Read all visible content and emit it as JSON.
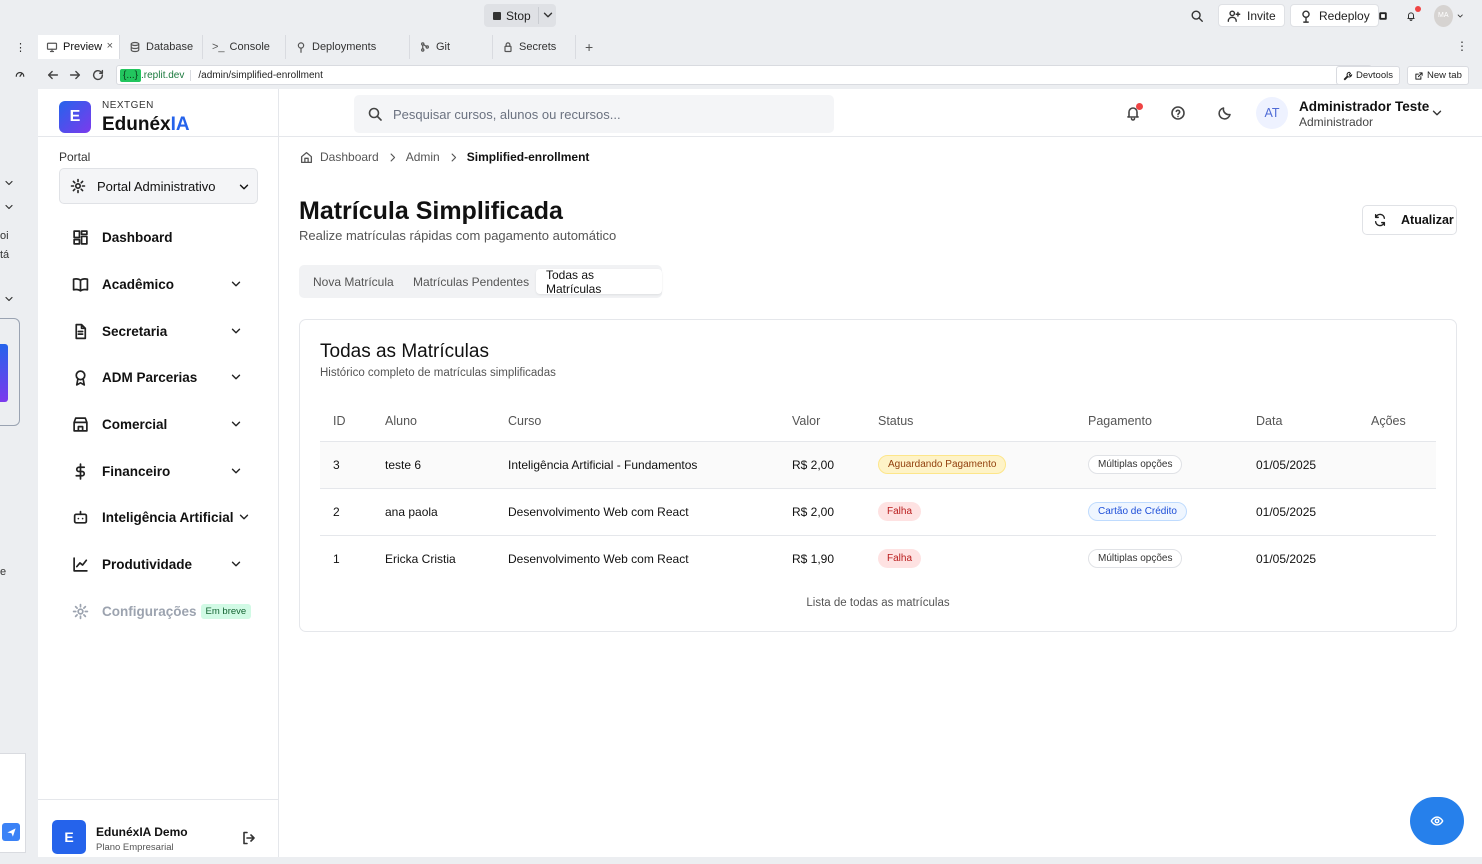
{
  "topbar": {
    "stop_label": "Stop",
    "invite_label": "Invite",
    "redeploy_label": "Redeploy",
    "avatar_initials": "MA"
  },
  "ide_tabs": [
    {
      "label": "Preview",
      "icon": "monitor-icon"
    },
    {
      "label": "Database",
      "icon": "database-icon"
    },
    {
      "label": "Console",
      "icon": "terminal-icon"
    },
    {
      "label": "Deployments",
      "icon": "deploy-icon"
    },
    {
      "label": "Git",
      "icon": "git-icon"
    },
    {
      "label": "Secrets",
      "icon": "lock-icon"
    }
  ],
  "address": {
    "host_badge": "{...}",
    "host": ".replit.dev",
    "path": "/admin/simplified-enrollment",
    "devtools_label": "Devtools",
    "newtab_label": "New tab"
  },
  "left_strip": {
    "snippet1": "oi",
    "snippet2": "tá",
    "snippet3": "e"
  },
  "brand": {
    "badge": "E",
    "small": "NEXTGEN",
    "name_main": "Edunéx",
    "name_accent": "IA"
  },
  "sidebar": {
    "portal_label": "Portal",
    "portal_value": "Portal Administrativo",
    "items": [
      {
        "label": "Dashboard",
        "icon": "dashboard-icon",
        "expandable": false
      },
      {
        "label": "Acadêmico",
        "icon": "book-icon",
        "expandable": true
      },
      {
        "label": "Secretaria",
        "icon": "document-icon",
        "expandable": true
      },
      {
        "label": "ADM Parcerias",
        "icon": "award-icon",
        "expandable": true
      },
      {
        "label": "Comercial",
        "icon": "store-icon",
        "expandable": true
      },
      {
        "label": "Financeiro",
        "icon": "dollar-icon",
        "expandable": true
      },
      {
        "label": "Inteligência Artificial",
        "icon": "bot-icon",
        "expandable": true
      },
      {
        "label": "Produtividade",
        "icon": "chart-line-icon",
        "expandable": true
      },
      {
        "label": "Configurações",
        "icon": "gear-icon",
        "expandable": false
      }
    ],
    "soon_badge": "Em breve",
    "user": {
      "avatar": "E",
      "name": "EdunéxIA Demo",
      "plan": "Plano Empresarial"
    }
  },
  "header": {
    "search_placeholder": "Pesquisar cursos, alunos ou recursos...",
    "avatar_initials": "AT",
    "user_name": "Administrador Teste",
    "user_role": "Administrador"
  },
  "breadcrumb": [
    "Dashboard",
    "Admin",
    "Simplified-enrollment"
  ],
  "page": {
    "title": "Matrícula Simplificada",
    "subtitle": "Realize matrículas rápidas com pagamento automático",
    "refresh_label": "Atualizar",
    "tabs": [
      "Nova Matrícula",
      "Matrículas Pendentes",
      "Todas as Matrículas"
    ],
    "active_tab": "Todas as Matrículas"
  },
  "card": {
    "title": "Todas as Matrículas",
    "subtitle": "Histórico completo de matrículas simplificadas",
    "columns": [
      "ID",
      "Aluno",
      "Curso",
      "Valor",
      "Status",
      "Pagamento",
      "Data",
      "Ações"
    ],
    "rows": [
      {
        "id": "3",
        "aluno": "teste 6",
        "curso": "Inteligência Artificial - Fundamentos",
        "valor": "R$ 2,00",
        "status": "Aguardando Pagamento",
        "pagamento": "Múltiplas opções",
        "data": "01/05/2025"
      },
      {
        "id": "2",
        "aluno": "ana paola",
        "curso": "Desenvolvimento Web com React",
        "valor": "R$ 2,00",
        "status": "Falha",
        "pagamento": "Cartão de Crédito",
        "data": "01/05/2025"
      },
      {
        "id": "1",
        "aluno": "Ericka Cristia",
        "curso": "Desenvolvimento Web com React",
        "valor": "R$ 1,90",
        "status": "Falha",
        "pagamento": "Múltiplas opções",
        "data": "01/05/2025"
      }
    ],
    "caption": "Lista de todas as matrículas"
  },
  "colors": {
    "accent": "#2563eb",
    "danger": "#ef4444",
    "warning_bg": "#fef3c7",
    "success_badge_bg": "#d1fae5"
  }
}
